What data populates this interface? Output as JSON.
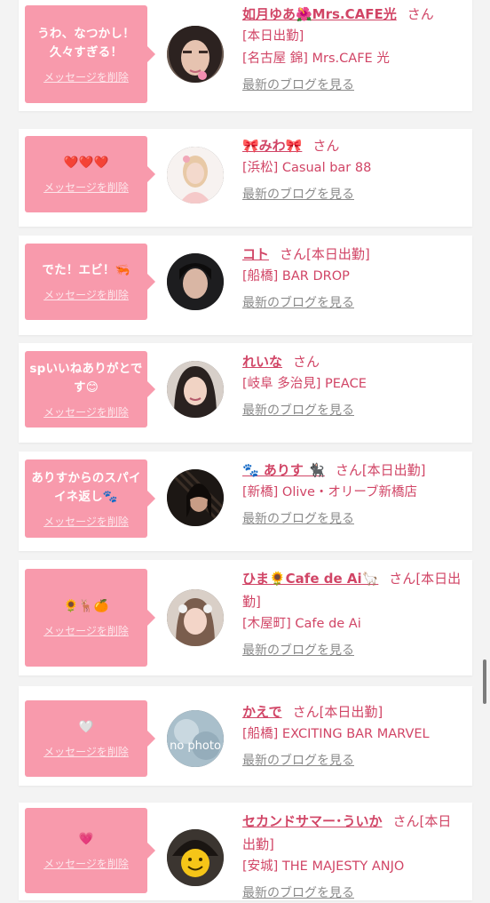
{
  "cards": [
    {
      "message": "うわ、なつかし！久々すぎる！",
      "delete_label": "メッセージを削除",
      "name": "如月ゆあ🌺Mrs.CAFE光",
      "san": "さん",
      "status": "",
      "shop_lines": [
        "[本日出勤]",
        "[名古屋 錦] Mrs.CAFE 光"
      ],
      "blog_label": "最新のブログを見る",
      "avatar": "avatar-woman-dark-hair"
    },
    {
      "message": "❤️❤️❤️",
      "delete_label": "メッセージを削除",
      "name": "🎀みわ🎀",
      "san": "さん",
      "status": "",
      "shop_lines": [
        "[浜松] Casual bar 88"
      ],
      "blog_label": "最新のブログを見る",
      "avatar": "avatar-woman-light"
    },
    {
      "message": "でた！エビ！🦐",
      "delete_label": "メッセージを削除",
      "name": "コト",
      "san": "さん",
      "status": "[本日出勤]",
      "shop_lines": [
        "[船橋] BAR DROP"
      ],
      "blog_label": "最新のブログを見る",
      "avatar": "avatar-woman-dark"
    },
    {
      "message": "spいいねありがとです😊",
      "delete_label": "メッセージを削除",
      "name": "れいな",
      "san": "さん",
      "status": "",
      "shop_lines": [
        "[岐阜 多治見] PEACE"
      ],
      "blog_label": "最新のブログを見る",
      "avatar": "avatar-woman-smile"
    },
    {
      "message": "ありすからのスパイイネ返し🐾",
      "delete_label": "メッセージを削除",
      "name": "🐾 ありす 🐈‍⬛",
      "san": "さん",
      "status": "[本日出勤]",
      "shop_lines": [
        "[新橋] Olive・オリーブ新橋店"
      ],
      "blog_label": "最新のブログを見る",
      "avatar": "avatar-woman-stairs"
    },
    {
      "message": "🌻🦌🍊",
      "delete_label": "メッセージを削除",
      "name": "ひま🌻Cafe de Ai🦙",
      "san": "さん",
      "status": "[本日出勤]",
      "shop_lines": [
        "[木屋町] Cafe de Ai"
      ],
      "blog_label": "最新のブログを見る",
      "avatar": "avatar-woman-peace"
    },
    {
      "message": "🤍",
      "delete_label": "メッセージを削除",
      "name": "かえで",
      "san": "さん",
      "status": "[本日出勤]",
      "shop_lines": [
        "[船橋] EXCITING BAR MARVEL"
      ],
      "blog_label": "最新のブログを見る",
      "avatar": "avatar-no-photo",
      "avatar_text": "no photo"
    },
    {
      "message": "💗",
      "delete_label": "メッセージを削除",
      "name": "セカンドサマー･ういか",
      "san": "さん",
      "status": "[本日出勤]",
      "shop_lines": [
        "[安城] THE MAJESTY ANJO"
      ],
      "blog_label": "最新のブログを見る",
      "avatar": "avatar-smiley-face"
    }
  ],
  "colors": {
    "bubble": "#f89aac",
    "accent_text": "#d14566",
    "link_gray": "#8a8a8a",
    "card": "#ffffff",
    "background": "#f3f3f3"
  }
}
